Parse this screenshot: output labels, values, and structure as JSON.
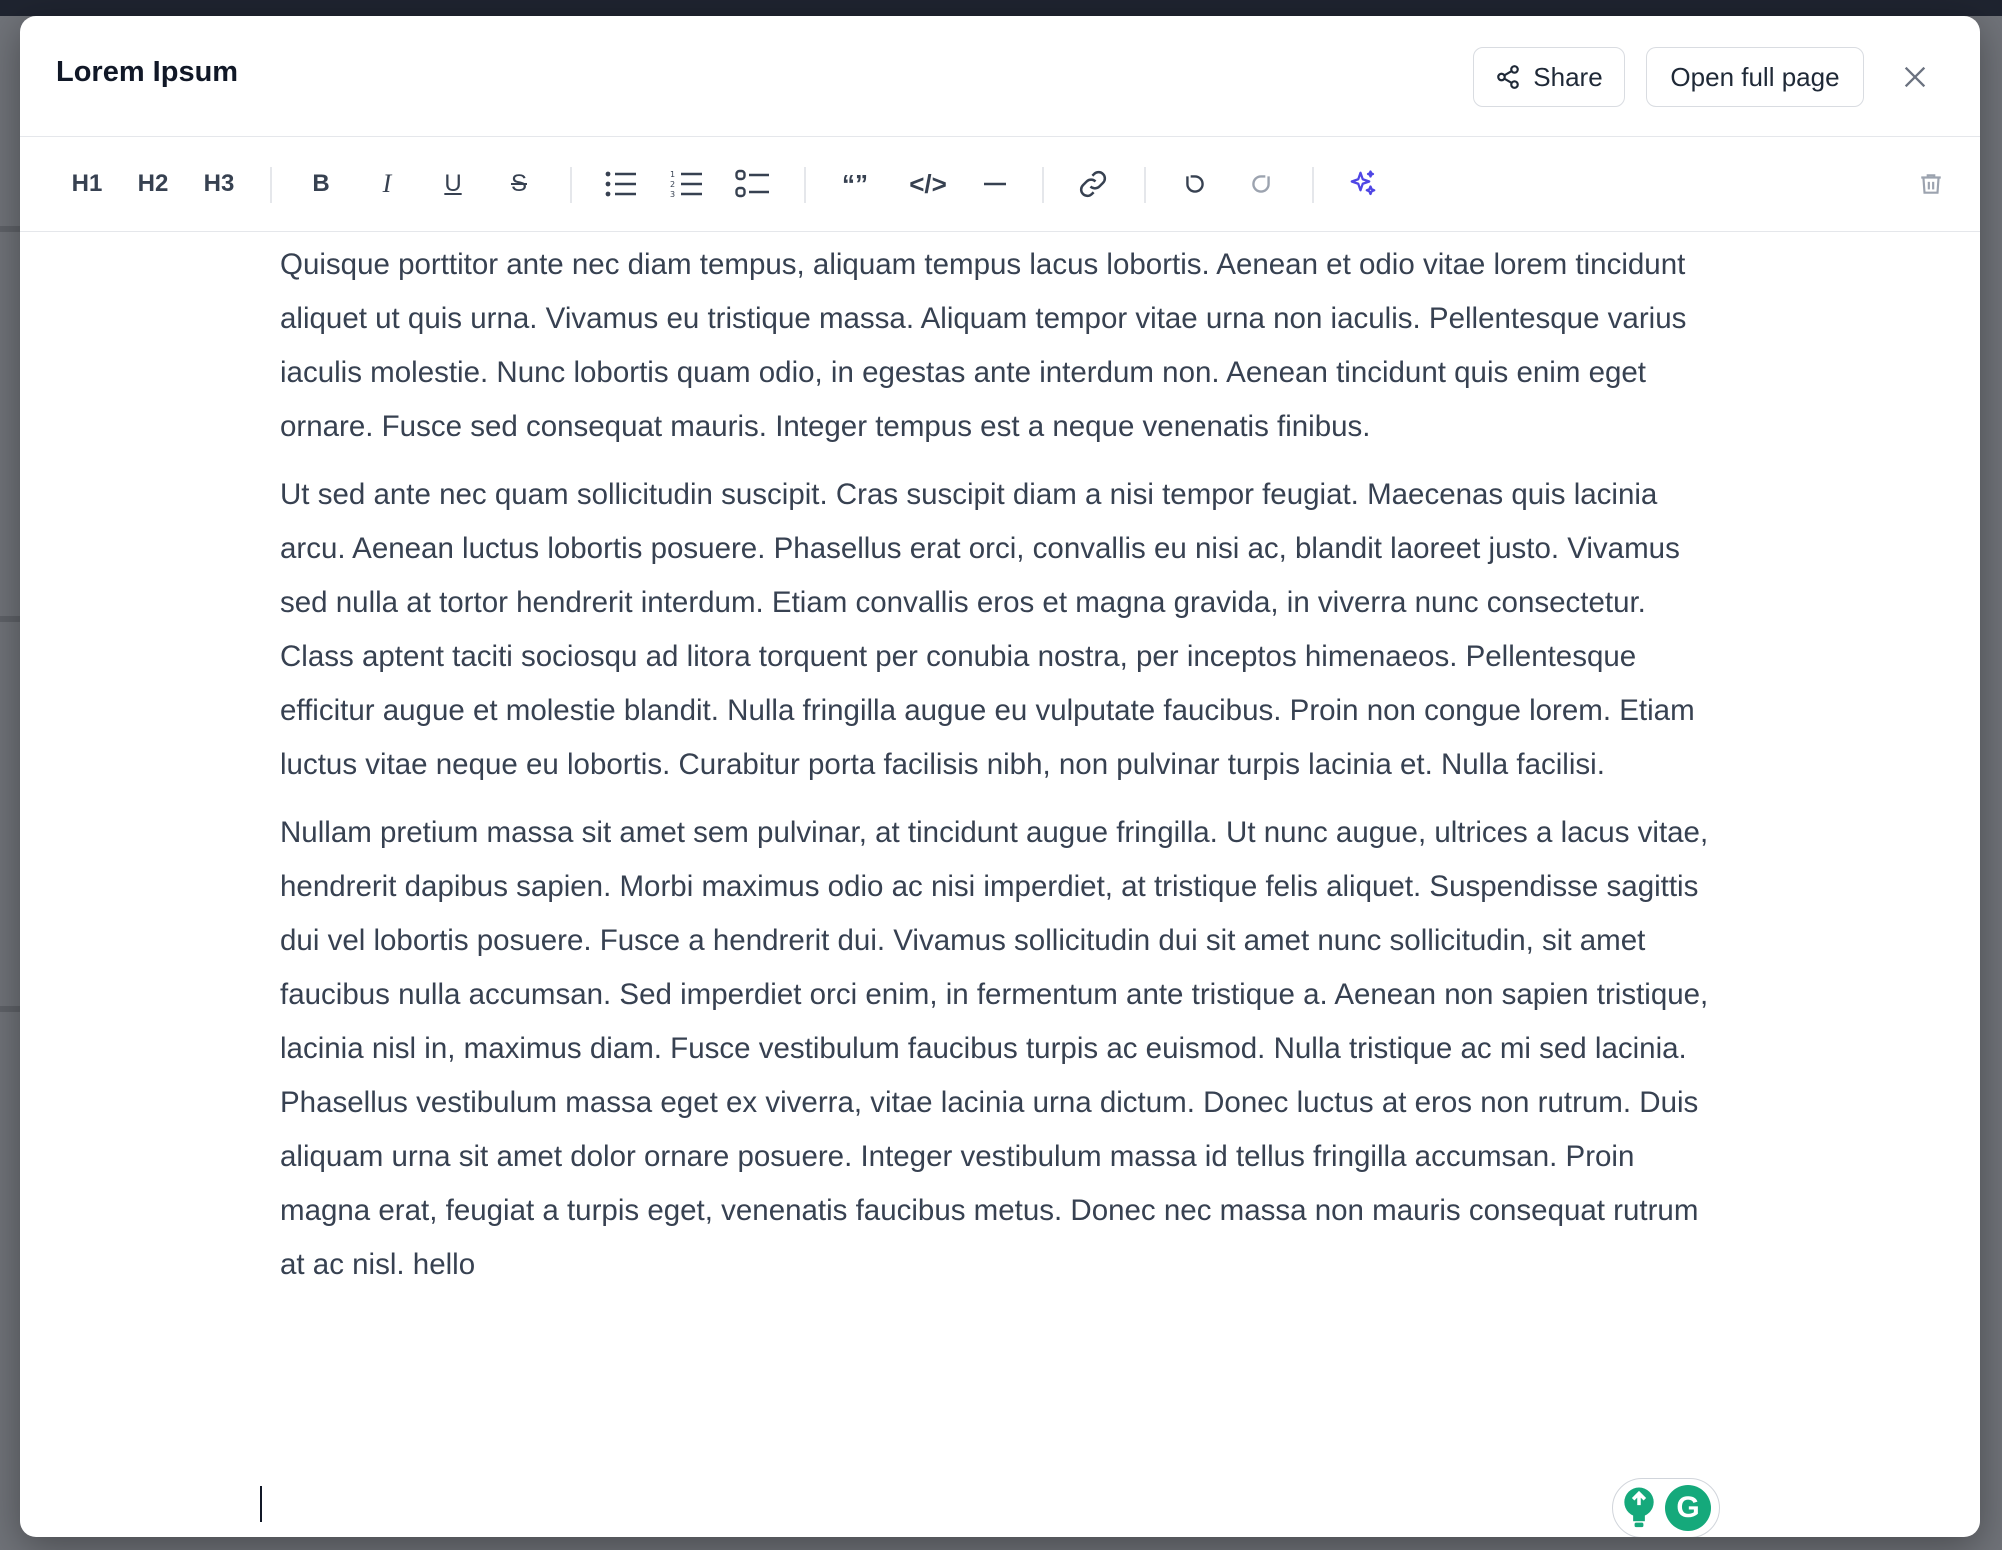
{
  "modal": {
    "title": "Lorem Ipsum",
    "share_label": "Share",
    "open_full_label": "Open full page"
  },
  "toolbar": {
    "h1": "H1",
    "h2": "H2",
    "h3": "H3",
    "bold": "B",
    "italic": "I",
    "underline": "U",
    "strike": "S",
    "quote": "“”",
    "code": "</>"
  },
  "editor": {
    "paragraphs": [
      "Quisque porttitor ante nec diam tempus, aliquam tempus lacus lobortis. Aenean et odio vitae lorem tincidunt aliquet ut quis urna. Vivamus eu tristique massa. Aliquam tempor vitae urna non iaculis. Pellentesque varius iaculis molestie. Nunc lobortis quam odio, in egestas ante interdum non. Aenean tincidunt quis enim eget ornare. Fusce sed consequat mauris. Integer tempus est a neque venenatis finibus.",
      "Ut sed ante nec quam sollicitudin suscipit. Cras suscipit diam a nisi tempor feugiat. Maecenas quis lacinia arcu. Aenean luctus lobortis posuere. Phasellus erat orci, convallis eu nisi ac, blandit laoreet justo. Vivamus sed nulla at tortor hendrerit interdum. Etiam convallis eros et magna gravida, in viverra nunc consectetur. Class aptent taciti sociosqu ad litora torquent per conubia nostra, per inceptos himenaeos. Pellentesque efficitur augue et molestie blandit. Nulla fringilla augue eu vulputate faucibus. Proin non congue lorem. Etiam luctus vitae neque eu lobortis. Curabitur porta facilisis nibh, non pulvinar turpis lacinia et. Nulla facilisi.",
      "Nullam pretium massa sit amet sem pulvinar, at tincidunt augue fringilla. Ut nunc augue, ultrices a lacus vitae, hendrerit dapibus sapien. Morbi maximus odio ac nisi imperdiet, at tristique felis aliquet. Suspendisse sagittis dui vel lobortis posuere. Fusce a hendrerit dui. Vivamus sollicitudin dui sit amet nunc sollicitudin, sit amet faucibus nulla accumsan. Sed imperdiet orci enim, in fermentum ante tristique a. Aenean non sapien tristique, lacinia nisl in, maximus diam. Fusce vestibulum faucibus turpis ac euismod. Nulla tristique ac mi sed lacinia. Phasellus vestibulum massa eget ex viverra, vitae lacinia urna dictum. Donec luctus at eros non rutrum. Duis aliquam urna sit amet dolor ornare posuere. Integer vestibulum massa id tellus fringilla accumsan. Proin magna erat, feugiat a turpis eget, venenatis faucibus metus. Donec nec massa non mauris consequat rutrum at ac nisl. hello"
    ]
  },
  "grammarly": {
    "letter": "G"
  },
  "colors": {
    "accent_ai": "#4f46e5",
    "grammarly": "#15a97b",
    "text": "#374151"
  },
  "icons": [
    "share-icon",
    "close-icon",
    "bullet-list-icon",
    "ordered-list-icon",
    "task-list-icon",
    "horizontal-rule-icon",
    "link-icon",
    "undo-icon",
    "redo-icon",
    "ai-sparkles-icon",
    "trash-icon",
    "lightbulb-icon"
  ]
}
